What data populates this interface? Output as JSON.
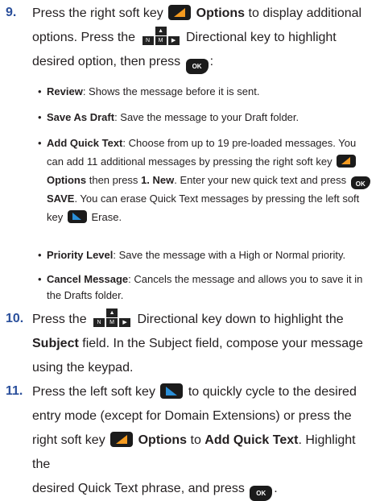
{
  "steps": [
    {
      "num": "9.",
      "lines": {
        "l1a": "Press the right soft key",
        "l1b": "Options",
        "l1c": "to display additional",
        "l2a": "options. Press the",
        "l2b": "Directional key to highlight",
        "l3a": "desired option, then press",
        "l3b": ":"
      }
    },
    {
      "num": "10.",
      "lines": {
        "l1a": "Press the",
        "l1b": "Directional key down to highlight the",
        "l2a": "Subject",
        "l2b": "field. In the Subject field, compose your message",
        "l3": "using the keypad."
      }
    },
    {
      "num": "11.",
      "lines": {
        "l1a": "Press the left soft key",
        "l1b": "to quickly cycle to the desired",
        "l2": "entry mode (except for Domain Extensions) or press the",
        "l3a": "right soft key",
        "l3b": "Options",
        "l3c": "to",
        "l3d": "Add Quick Text",
        "l3e": ". Highlight the",
        "l4a": "desired Quick Text phrase, and press",
        "l4b": "."
      }
    }
  ],
  "bullets": {
    "review": {
      "term": "Review",
      "text": ": Shows the message before it is sent."
    },
    "save_draft": {
      "term": "Save As Draft",
      "text": ": Save the message to your Draft folder."
    },
    "quick_text": {
      "term": "Add Quick Text",
      "t1": ": Choose from up to 19 pre-loaded messages. You",
      "t2": "can add 11 additional messages by pressing the right soft key",
      "t3a": "Options",
      "t3b": "then press",
      "t3c": "1. New",
      "t3d": ". Enter your new quick text and press",
      "t4a": "SAVE",
      "t4b": ". You can erase Quick Text messages by pressing the left soft",
      "t5a": "key",
      "t5b": "Erase."
    },
    "priority": {
      "term": "Priority Level",
      "text": ": Save the message with a High or Normal priority."
    },
    "cancel": {
      "term": "Cancel Message",
      "t1": ": Cancels the message and allows you to save it in",
      "t2": "the Drafts folder."
    }
  },
  "key_labels": {
    "ok": "OK",
    "up": "▲",
    "left": "N",
    "center": "M",
    "right": "▶"
  },
  "bullet_glyph": "•",
  "colors": {
    "step_number": "#2a4f9b",
    "text": "#231f20",
    "right_key": "#f49a1f",
    "left_key": "#2a8fd8"
  }
}
